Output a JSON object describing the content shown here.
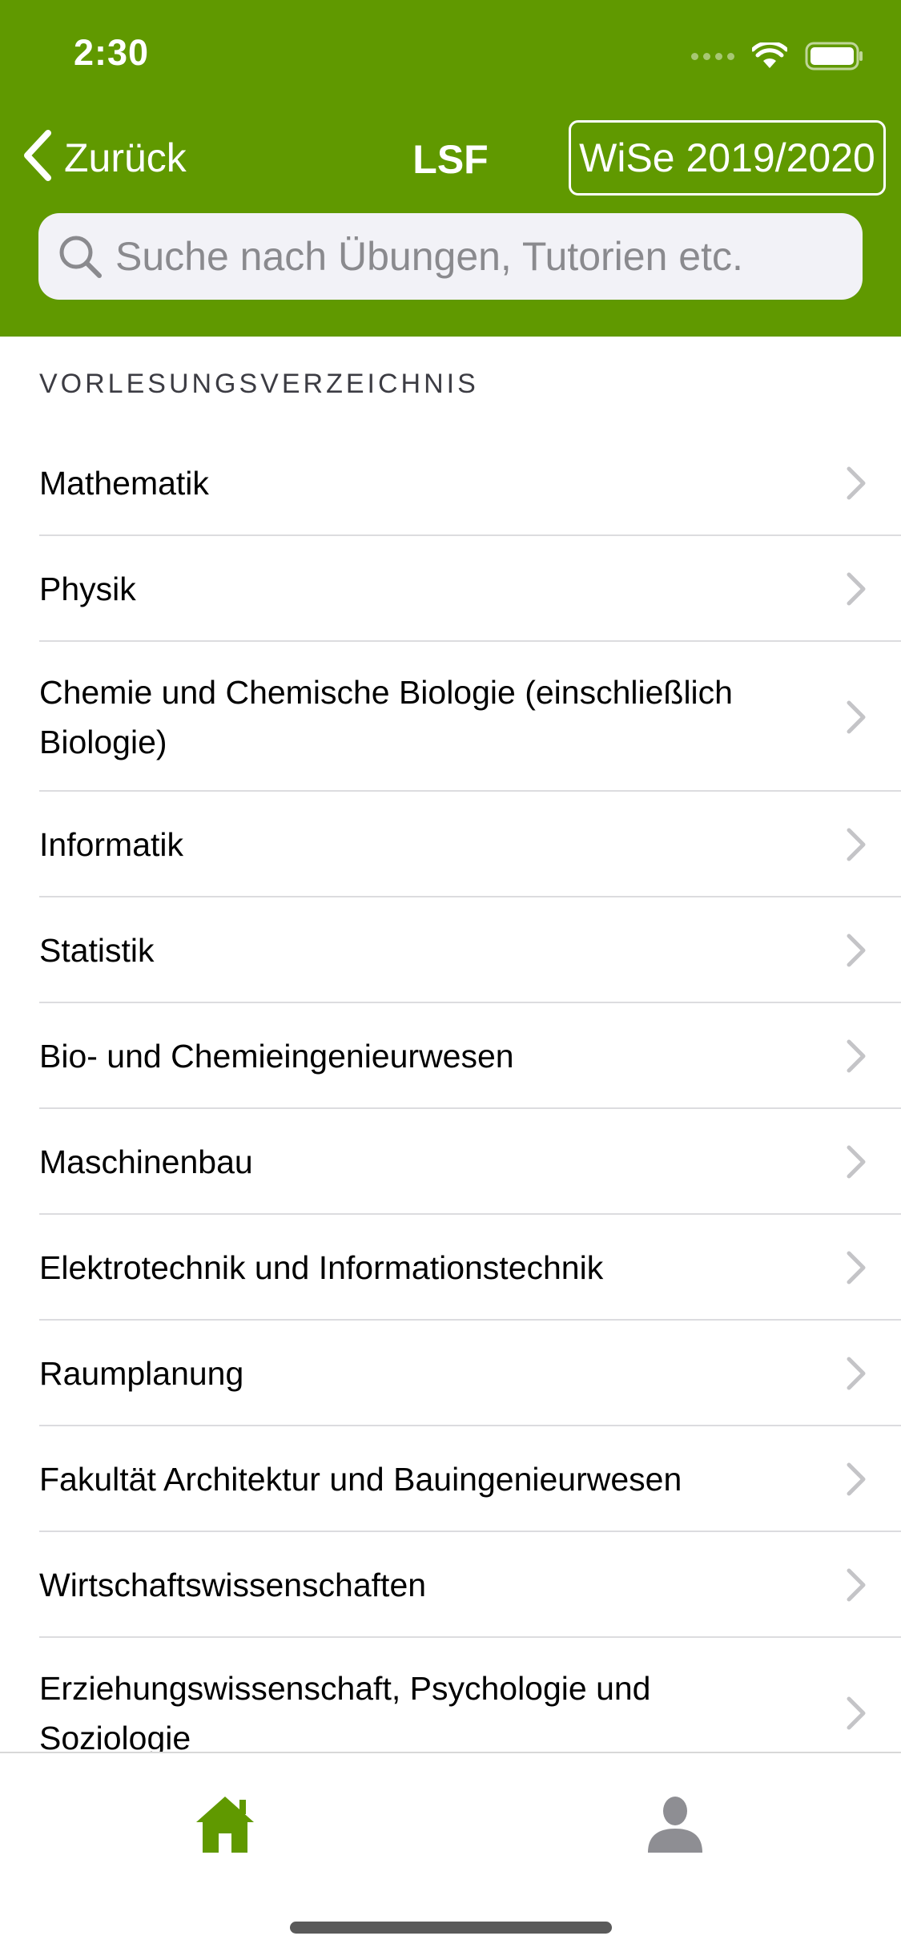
{
  "status_bar": {
    "time": "2:30"
  },
  "nav": {
    "back_label": "Zurück",
    "title": "LSF",
    "semester_label": "WiSe 2019/2020"
  },
  "search": {
    "placeholder": "Suche nach Übungen, Tutorien etc."
  },
  "section": {
    "header": "VORLESUNGSVERZEICHNIS"
  },
  "list": {
    "items": [
      {
        "label": "Mathematik"
      },
      {
        "label": "Physik"
      },
      {
        "label": "Chemie und Chemische Biologie (einschließlich Biologie)"
      },
      {
        "label": "Informatik"
      },
      {
        "label": "Statistik"
      },
      {
        "label": "Bio- und Chemieingenieurwesen"
      },
      {
        "label": "Maschinenbau"
      },
      {
        "label": "Elektrotechnik und Informationstechnik"
      },
      {
        "label": "Raumplanung"
      },
      {
        "label": "Fakultät Architektur und Bauingenieurwesen"
      },
      {
        "label": "Wirtschaftswissenschaften"
      },
      {
        "label": "Erziehungswissenschaft, Psychologie und Soziologie"
      }
    ]
  },
  "tabbar": {
    "tabs": [
      {
        "icon": "home-icon",
        "active": true
      },
      {
        "icon": "person-icon",
        "active": false
      }
    ]
  },
  "colors": {
    "brand_green": "#609900",
    "search_bg": "#f2f2f7",
    "chevron": "#c4c4c7",
    "inactive_tab": "#8e8e93"
  }
}
